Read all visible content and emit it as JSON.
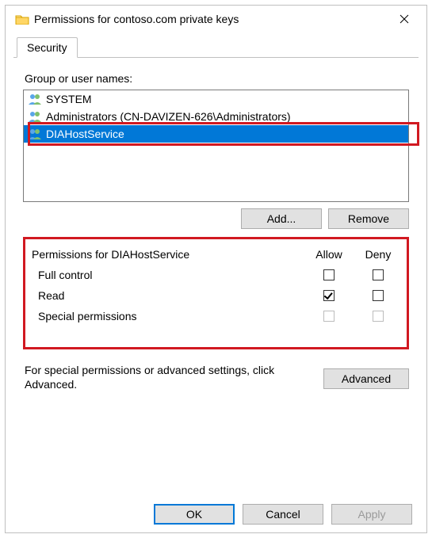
{
  "window": {
    "title": "Permissions for contoso.com private keys"
  },
  "tab": {
    "security": "Security"
  },
  "labels": {
    "group_or_user_names": "Group or user names:",
    "add": "Add...",
    "remove": "Remove",
    "permissions_for": "Permissions for DIAHostService",
    "allow": "Allow",
    "deny": "Deny",
    "advanced_hint": "For special permissions or advanced settings, click Advanced.",
    "advanced": "Advanced",
    "ok": "OK",
    "cancel": "Cancel",
    "apply": "Apply"
  },
  "users": {
    "0": {
      "name": "SYSTEM"
    },
    "1": {
      "name": "Administrators (CN-DAVIZEN-626\\Administrators)"
    },
    "2": {
      "name": "DIAHostService"
    }
  },
  "perms": {
    "0": {
      "name": "Full control",
      "allow": false,
      "deny": false,
      "disabled": false
    },
    "1": {
      "name": "Read",
      "allow": true,
      "deny": false,
      "disabled": false
    },
    "2": {
      "name": "Special permissions",
      "allow": false,
      "deny": false,
      "disabled": true
    }
  }
}
